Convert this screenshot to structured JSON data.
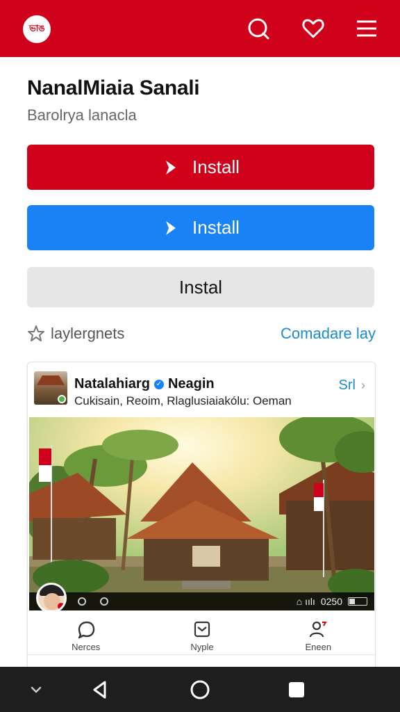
{
  "topbar": {
    "logo_text": "ভাঙ",
    "brand_color": "#d0021b",
    "icons": [
      "search-icon",
      "heart-icon",
      "menu-icon"
    ]
  },
  "app": {
    "title": "NanalMiaia Sanali",
    "subtitle": "Barolrya lanacla"
  },
  "buttons": {
    "install_red": "Install",
    "install_blue": "Install",
    "install_gray": "Instal"
  },
  "meta": {
    "rating_label": "laylergnets",
    "compare_link": "Comadare lay"
  },
  "card": {
    "name": "Natalahiarg",
    "name2": "Neagin",
    "subtitle": "Cukisain, Reoim, Rlaglusiaiakólu: Oeman",
    "more_label": "Srl",
    "video_time": "0250",
    "nav": [
      {
        "label": "Nerces",
        "icon": "chat-icon"
      },
      {
        "label": "Nyple",
        "icon": "inbox-icon"
      },
      {
        "label": "Eneen",
        "icon": "profile-icon"
      }
    ]
  },
  "colors": {
    "red": "#d0021b",
    "blue": "#1a82f7",
    "gray_button": "#e6e6e6",
    "link": "#1a8ccf"
  },
  "system_nav": [
    "chevron-down-icon",
    "back-icon",
    "home-icon",
    "recents-icon"
  ]
}
